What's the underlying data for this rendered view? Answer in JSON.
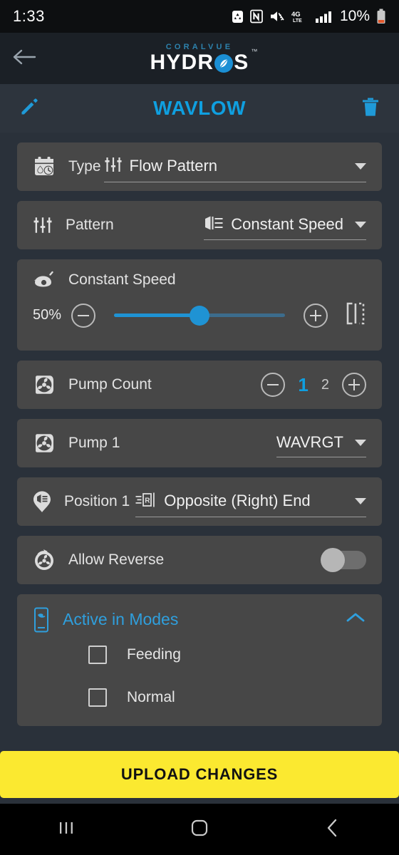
{
  "status_bar": {
    "time": "1:33",
    "battery_percent": "10%",
    "network": "4G LTE",
    "icons": [
      "recycle-app-icon",
      "nfc-icon",
      "vibrate-mute-icon",
      "4g-lte-icon",
      "signal-bars-icon",
      "battery-low-icon"
    ]
  },
  "app_bar": {
    "brand_top": "CORALVUE",
    "brand_main_a": "HYDR",
    "brand_main_b": "S",
    "trademark": "™",
    "back_icon": "arrow-left-icon"
  },
  "title_bar": {
    "title": "WAVLOW",
    "edit_icon": "pencil-icon",
    "delete_icon": "trash-icon"
  },
  "rows": {
    "type": {
      "label": "Type",
      "value": "Flow Pattern",
      "icon": "calendar-water-clock-icon",
      "value_icon": "tune-sliders-icon"
    },
    "pattern": {
      "label": "Pattern",
      "value": "Constant Speed",
      "icon": "tune-sliders-icon",
      "value_icon": "speed-wave-icon"
    },
    "constant_speed": {
      "title": "Constant Speed",
      "icon": "speedometer-icon",
      "percent_label": "50%",
      "percent_value": 50,
      "minus_icon": "minus-circle-icon",
      "plus_icon": "plus-circle-icon",
      "preview_icon": "preview-split-icon"
    },
    "pump_count": {
      "label": "Pump Count",
      "icon": "pump-propeller-icon",
      "minus_icon": "minus-circle-icon",
      "plus_icon": "plus-circle-icon",
      "selected": "1",
      "unselected": "2"
    },
    "pump_1": {
      "label": "Pump 1",
      "value": "WAVRGT",
      "icon": "pump-propeller-icon"
    },
    "position_1": {
      "label": "Position 1",
      "value": "Opposite (Right) End",
      "icon": "map-pin-icon",
      "value_icon": "flow-right-end-icon"
    },
    "allow_reverse": {
      "label": "Allow Reverse",
      "icon": "reverse-propeller-icon",
      "toggle_state": "off"
    }
  },
  "active_in_modes": {
    "title": "Active in Modes",
    "icon": "tank-mode-icon",
    "collapse_icon": "chevron-up-icon",
    "items": [
      {
        "label": "Feeding",
        "checked": false
      },
      {
        "label": "Normal",
        "checked": false
      }
    ]
  },
  "upload": {
    "label": "UPLOAD CHANGES"
  },
  "nav_bar": {
    "recents_icon": "recents-bars-icon",
    "home_icon": "home-square-icon",
    "back_icon": "chevron-left-icon"
  },
  "colors": {
    "accent_blue": "#0f9fe0",
    "slider_blue": "#1f93d4",
    "card_bg": "#474747",
    "page_bg": "#2a313a",
    "upload_yellow": "#fbe930"
  }
}
